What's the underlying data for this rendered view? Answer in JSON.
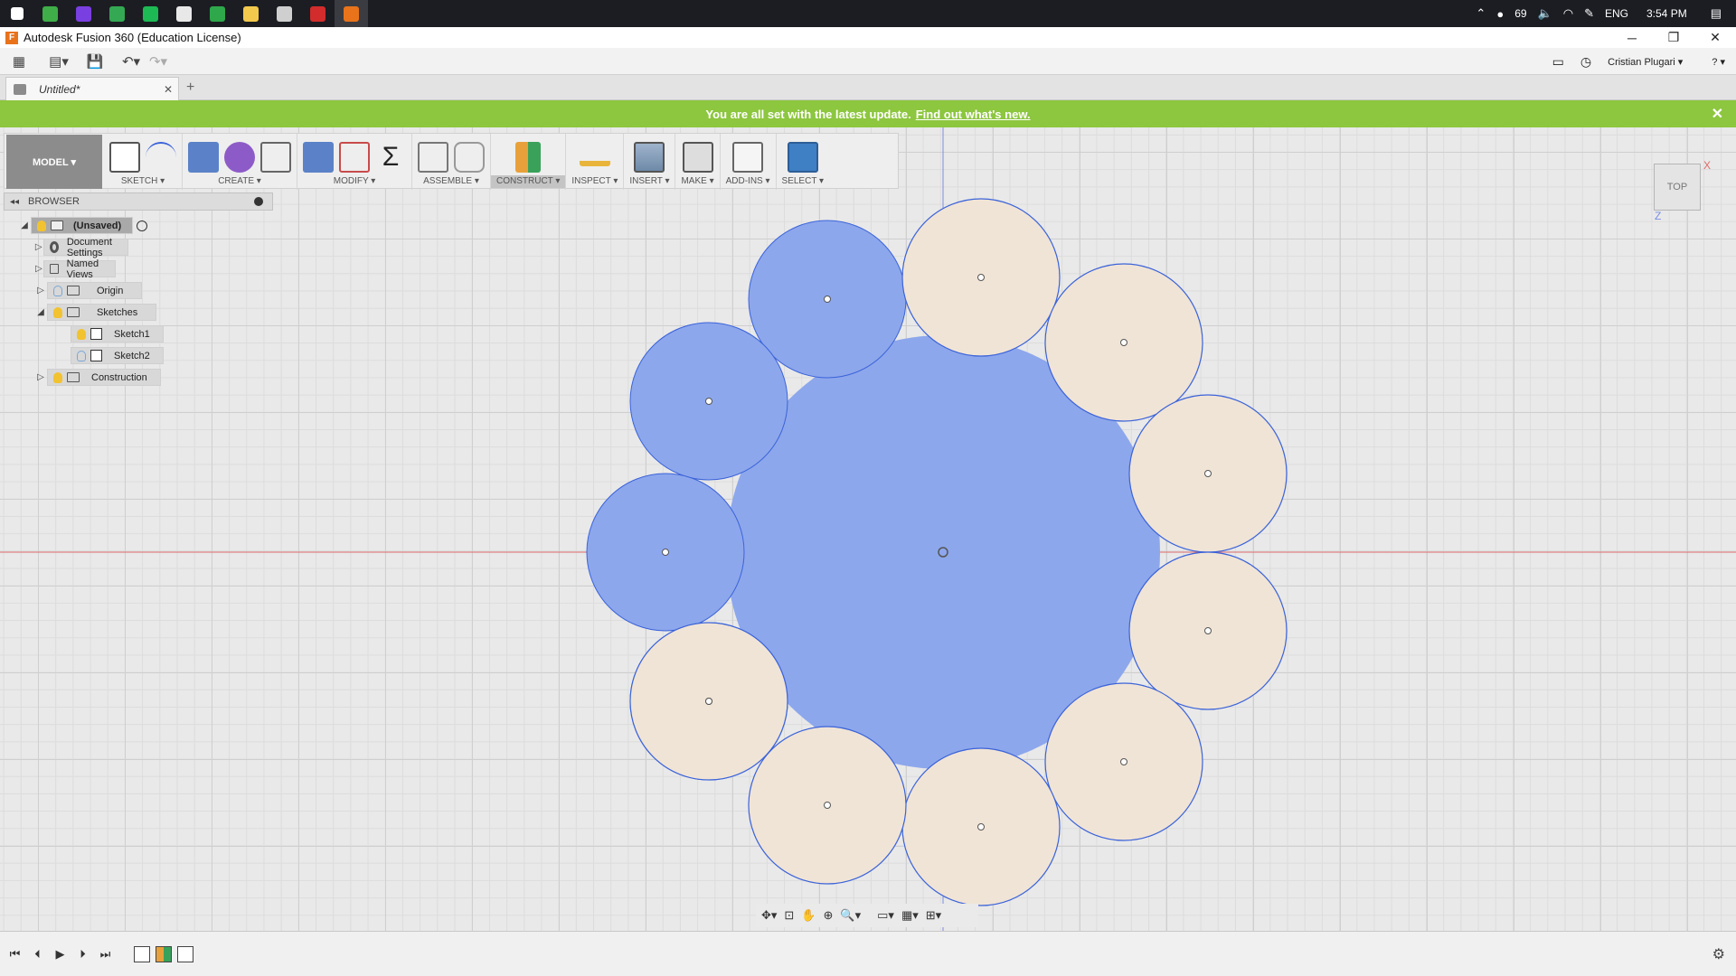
{
  "taskbar": {
    "apps": [
      {
        "name": "start",
        "color": "#ffffff"
      },
      {
        "name": "app-green",
        "color": "#3fae49"
      },
      {
        "name": "firefox",
        "color": "#7a3fe0"
      },
      {
        "name": "chrome",
        "color": "#34a853"
      },
      {
        "name": "spotify",
        "color": "#1db954"
      },
      {
        "name": "git",
        "color": "#e8e8e8"
      },
      {
        "name": "telegram-like",
        "color": "#2ea84b"
      },
      {
        "name": "explorer",
        "color": "#f2c94c"
      },
      {
        "name": "calculator",
        "color": "#cfcfcf"
      },
      {
        "name": "acrobat",
        "color": "#d22c2c"
      },
      {
        "name": "fusion",
        "color": "#e8731b"
      }
    ],
    "temp": "69",
    "lang": "ENG",
    "time": "3:54 PM"
  },
  "window": {
    "title": "Autodesk Fusion 360 (Education License)"
  },
  "app_toolbar": {
    "user": "Cristian Plugari ▾",
    "help": "? ▾"
  },
  "tabs": {
    "doc_title": "Untitled*",
    "close": "✕",
    "new": "+"
  },
  "notification": {
    "message": "You are all set with the latest update.",
    "link": "Find out what's new.",
    "close": "✕"
  },
  "ribbon": {
    "workspace": "MODEL ▾",
    "groups": [
      {
        "label": "SKETCH ▾"
      },
      {
        "label": "CREATE ▾"
      },
      {
        "label": "MODIFY ▾"
      },
      {
        "label": "ASSEMBLE ▾"
      },
      {
        "label": "CONSTRUCT ▾"
      },
      {
        "label": "INSPECT ▾"
      },
      {
        "label": "INSERT ▾"
      },
      {
        "label": "MAKE ▾"
      },
      {
        "label": "ADD-INS ▾"
      },
      {
        "label": "SELECT ▾"
      }
    ]
  },
  "browser": {
    "title": "BROWSER",
    "nodes": [
      {
        "label": "(Unsaved)"
      },
      {
        "label": "Document Settings"
      },
      {
        "label": "Named Views"
      },
      {
        "label": "Origin"
      },
      {
        "label": "Sketches"
      },
      {
        "label": "Sketch1"
      },
      {
        "label": "Sketch2"
      },
      {
        "label": "Construction"
      }
    ]
  },
  "viewcube": {
    "face": "TOP",
    "x_axis": "X",
    "z_axis": "Z"
  },
  "colors": {
    "profile_fill": "#8da7ec",
    "circle_fill": "#f0e4d6",
    "sketch_line": "#3b63d9",
    "notify_bg": "#8dc63f",
    "axis_red": "#e06a6a",
    "axis_blue": "#7d8de0"
  }
}
